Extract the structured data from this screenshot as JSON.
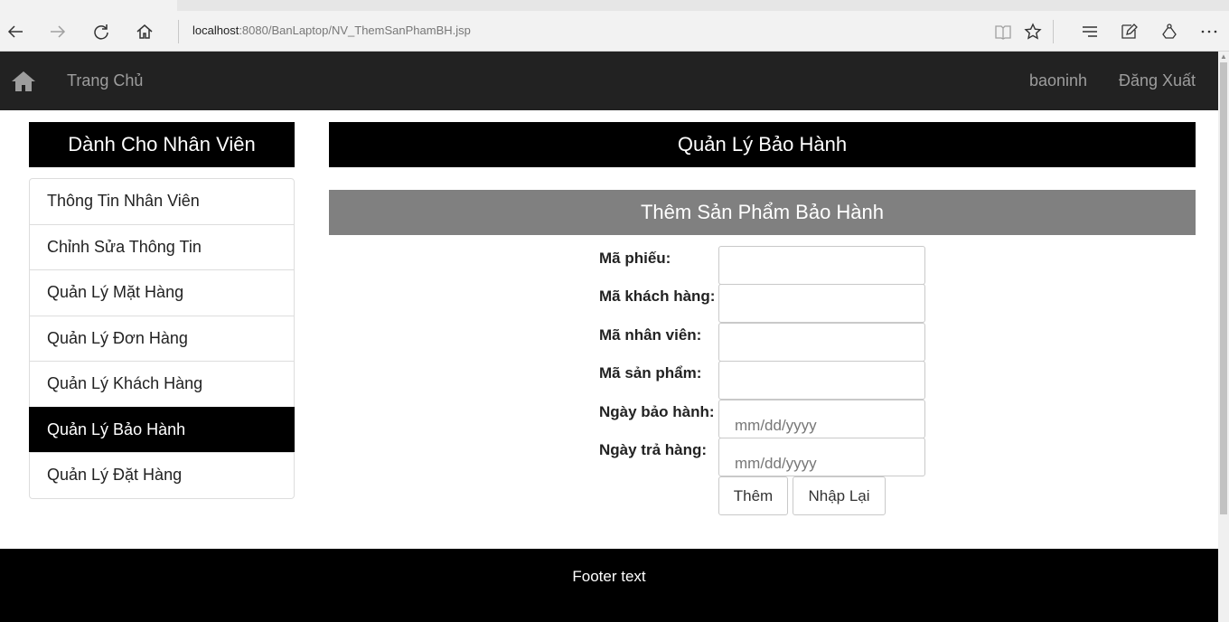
{
  "browser": {
    "url_host": "localhost",
    "url_rest": ":8080/BanLaptop/NV_ThemSanPhamBH.jsp"
  },
  "navbar": {
    "home_link": "Trang Chủ",
    "username": "baoninh",
    "logout": "Đăng Xuất"
  },
  "sidebar": {
    "title": "Dành Cho Nhân Viên",
    "items": [
      {
        "label": "Thông Tin Nhân Viên"
      },
      {
        "label": "Chỉnh Sửa Thông Tin"
      },
      {
        "label": "Quản Lý Mặt Hàng"
      },
      {
        "label": "Quản Lý Đơn Hàng"
      },
      {
        "label": "Quản Lý Khách Hàng"
      },
      {
        "label": "Quản Lý Bảo Hành"
      },
      {
        "label": "Quản Lý Đặt Hàng"
      }
    ],
    "active_item": "Quản Lý Bảo Hành"
  },
  "main": {
    "title": "Quản Lý Bảo Hành",
    "subtitle": "Thêm Sản Phẩm Bảo Hành",
    "form": {
      "ma_phieu": {
        "label": "Mã phiếu:",
        "value": ""
      },
      "ma_khach_hang": {
        "label": "Mã khách hàng:",
        "value": ""
      },
      "ma_nhan_vien": {
        "label": "Mã nhân viên:",
        "value": ""
      },
      "ma_san_pham": {
        "label": "Mã sản phẩm:",
        "value": ""
      },
      "ngay_bao_hanh": {
        "label": "Ngày bảo hành:",
        "placeholder": "mm/dd/yyyy"
      },
      "ngay_tra_hang": {
        "label": "Ngày trả hàng:",
        "placeholder": "mm/dd/yyyy"
      },
      "submit_label": "Thêm",
      "reset_label": "Nhập Lại"
    }
  },
  "footer": {
    "text": "Footer text"
  }
}
